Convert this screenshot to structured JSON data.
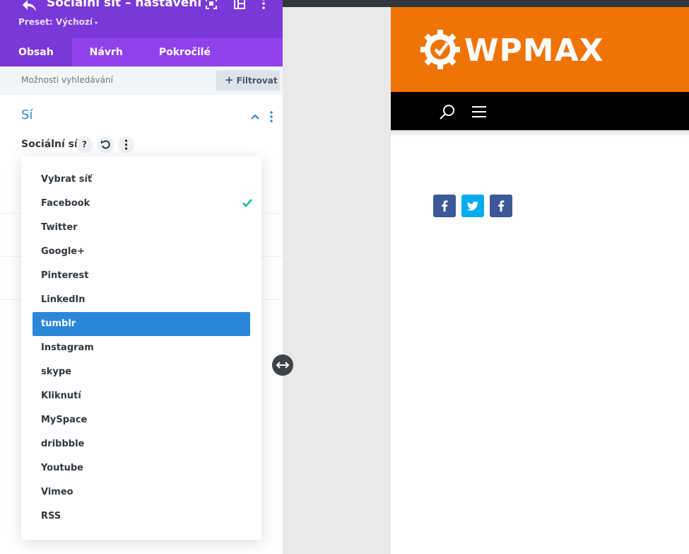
{
  "panel": {
    "title": "Sociální síť – nastavení",
    "preset_label": "Preset: Výchozí",
    "preset_caret": "▾",
    "tabs": [
      {
        "label": "Obsah",
        "active": true
      },
      {
        "label": "Návrh",
        "active": false
      },
      {
        "label": "Pokročilé",
        "active": false
      }
    ],
    "search_placeholder": "Možnosti vyhledávání",
    "filter_label": "Filtrovat",
    "filter_plus": "+",
    "section_title": "Sí",
    "field_label": "Sociální síť",
    "help_label": "?"
  },
  "dropdown": {
    "options": [
      {
        "label": "Vybrat síť"
      },
      {
        "label": "Facebook",
        "checked": true
      },
      {
        "label": "Twitter"
      },
      {
        "label": "Google+"
      },
      {
        "label": "Pinterest"
      },
      {
        "label": "LinkedIn"
      },
      {
        "label": "tumblr",
        "highlighted": true
      },
      {
        "label": "Instagram"
      },
      {
        "label": "skype"
      },
      {
        "label": "Kliknutí"
      },
      {
        "label": "MySpace"
      },
      {
        "label": "dribbble"
      },
      {
        "label": "Youtube"
      },
      {
        "label": "Vimeo"
      },
      {
        "label": "RSS"
      }
    ]
  },
  "site": {
    "logo_text": "WPMAX",
    "social_icons": [
      {
        "name": "facebook-icon",
        "color": "#3b5998"
      },
      {
        "name": "twitter-icon",
        "color": "#00aced"
      },
      {
        "name": "facebook-icon",
        "color": "#3b5998"
      }
    ]
  },
  "colors": {
    "header_purple": "#7b38d8",
    "tabs_purple": "#8f42ec",
    "accent_blue": "#2b87da",
    "check_green": "#29c4a9",
    "site_orange": "#f07306"
  }
}
